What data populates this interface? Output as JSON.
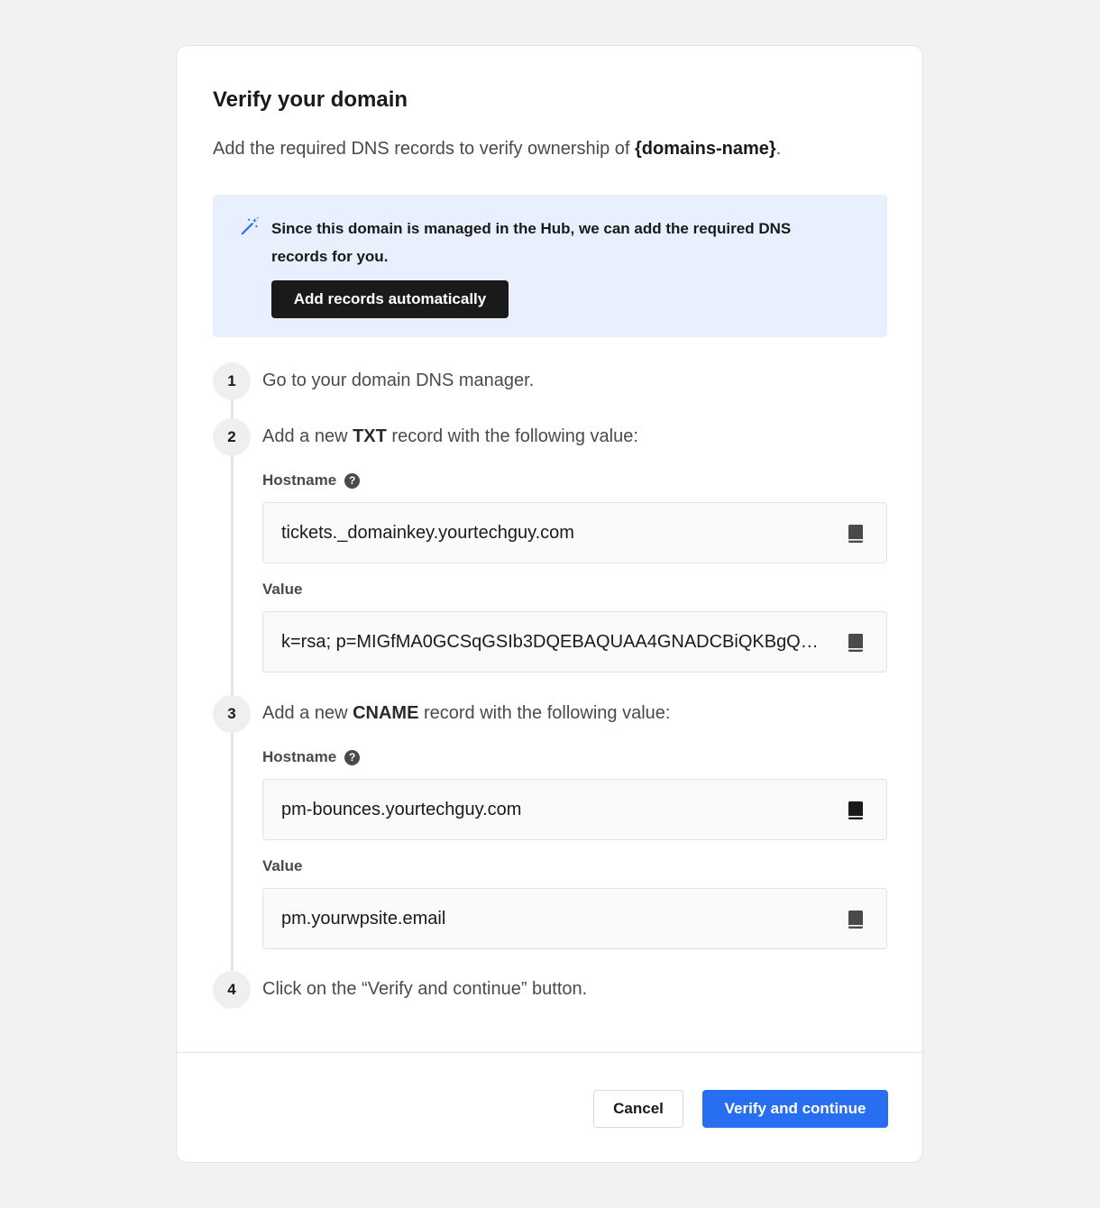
{
  "modal": {
    "title": "Verify your domain",
    "subtitle_prefix": "Add the required DNS records to verify ownership of ",
    "subtitle_domain": "{domains-name}",
    "subtitle_suffix": "."
  },
  "info_box": {
    "icon": "magic-wand-icon",
    "text": "Since this domain is managed in the Hub, we can add the required DNS records for you.",
    "button_label": "Add records automatically",
    "background": "#e8effd"
  },
  "steps": [
    {
      "number": "1",
      "text": "Go to your domain DNS manager."
    },
    {
      "number": "2",
      "text_prefix": "Add a new ",
      "record_type": "TXT",
      "text_suffix": " record with the following value:",
      "hostname_label": "Hostname",
      "hostname": "tickets._domainkey.yourtechguy.com",
      "value_label": "Value",
      "value": "k=rsa; p=MIGfMA0GCSqGSIb3DQEBAQUAA4GNADCBiQKBgQ…"
    },
    {
      "number": "3",
      "text_prefix": "Add a new ",
      "record_type": "CNAME",
      "text_suffix": " record with the following value:",
      "hostname_label": "Hostname",
      "hostname": "pm-bounces.yourtechguy.com",
      "value_label": "Value",
      "value": "pm.yourwpsite.email"
    },
    {
      "number": "4",
      "text": "Click on the “Verify and continue” button."
    }
  ],
  "footer": {
    "cancel_label": "Cancel",
    "verify_label": "Verify and continue"
  },
  "colors": {
    "primary": "#286ef1",
    "dark_button": "#1a1a1a",
    "page_background": "#f2f2f2"
  }
}
